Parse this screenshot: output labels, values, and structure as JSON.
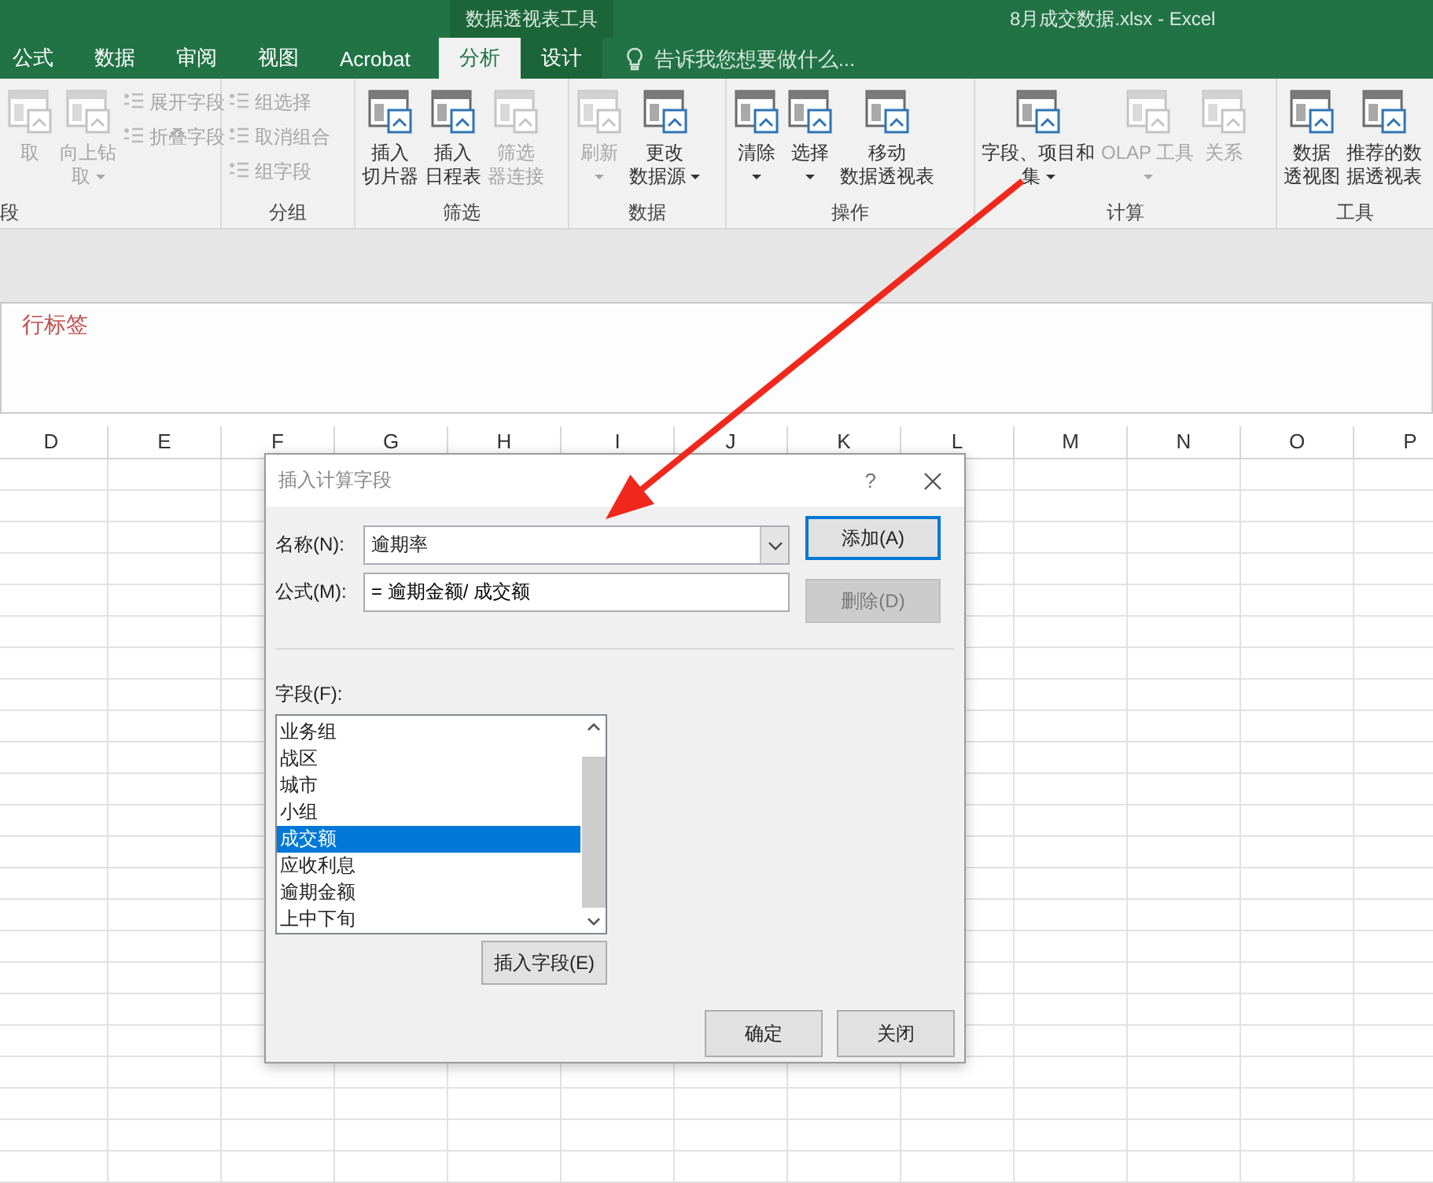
{
  "title_bar": {
    "context_group": "数据透视表工具",
    "document_title": "8月成交数据.xlsx - Excel"
  },
  "tabs": [
    {
      "label": "公式",
      "selected": false,
      "contextual": false
    },
    {
      "label": "数据",
      "selected": false,
      "contextual": false
    },
    {
      "label": "审阅",
      "selected": false,
      "contextual": false
    },
    {
      "label": "视图",
      "selected": false,
      "contextual": false
    },
    {
      "label": "Acrobat",
      "selected": false,
      "contextual": false
    },
    {
      "label": "分析",
      "selected": true,
      "contextual": true
    },
    {
      "label": "设计",
      "selected": false,
      "contextual": true
    }
  ],
  "tell_me": {
    "placeholder": "告诉我您想要做什么..."
  },
  "ribbon_groups": [
    {
      "label": "段",
      "buttons": [
        {
          "kind": "large",
          "lines": [
            "取"
          ],
          "dropdown": false,
          "disabled": true
        },
        {
          "kind": "large",
          "lines": [
            "向上钻",
            "取"
          ],
          "dropdown": true,
          "disabled": true
        },
        {
          "kind": "small",
          "lines": [
            "展开字段"
          ],
          "disabled": true
        },
        {
          "kind": "small",
          "lines": [
            "折叠字段"
          ],
          "disabled": true
        }
      ]
    },
    {
      "label": "分组",
      "buttons": [
        {
          "kind": "small",
          "lines": [
            "组选择"
          ],
          "disabled": true
        },
        {
          "kind": "small",
          "lines": [
            "取消组合"
          ],
          "disabled": true
        },
        {
          "kind": "small",
          "lines": [
            "组字段"
          ],
          "disabled": true
        }
      ]
    },
    {
      "label": "筛选",
      "buttons": [
        {
          "kind": "large",
          "lines": [
            "插入",
            "切片器"
          ],
          "dropdown": false,
          "disabled": false
        },
        {
          "kind": "large",
          "lines": [
            "插入",
            "日程表"
          ],
          "dropdown": false,
          "disabled": false
        },
        {
          "kind": "large",
          "lines": [
            "筛选",
            "器连接"
          ],
          "dropdown": false,
          "disabled": true
        }
      ]
    },
    {
      "label": "数据",
      "buttons": [
        {
          "kind": "large",
          "lines": [
            "刷新"
          ],
          "dropdown": true,
          "disabled": true
        },
        {
          "kind": "large",
          "lines": [
            "更改",
            "数据源"
          ],
          "dropdown": true,
          "disabled": false
        }
      ]
    },
    {
      "label": "操作",
      "buttons": [
        {
          "kind": "large",
          "lines": [
            "清除"
          ],
          "dropdown": true,
          "disabled": false
        },
        {
          "kind": "large",
          "lines": [
            "选择"
          ],
          "dropdown": true,
          "disabled": false
        },
        {
          "kind": "large",
          "lines": [
            "移动",
            "数据透视表"
          ],
          "dropdown": false,
          "disabled": false
        }
      ]
    },
    {
      "label": "计算",
      "buttons": [
        {
          "kind": "large",
          "lines": [
            "字段、项目和",
            "集"
          ],
          "dropdown": true,
          "disabled": false
        },
        {
          "kind": "large",
          "lines": [
            "OLAP 工具"
          ],
          "dropdown": true,
          "disabled": true
        },
        {
          "kind": "large",
          "lines": [
            "关系"
          ],
          "dropdown": false,
          "disabled": true
        }
      ]
    },
    {
      "label": "工具",
      "buttons": [
        {
          "kind": "large",
          "lines": [
            "数据",
            "透视图"
          ],
          "dropdown": false,
          "disabled": false
        },
        {
          "kind": "large",
          "lines": [
            "推荐的数",
            "据透视表"
          ],
          "dropdown": false,
          "disabled": false
        }
      ]
    }
  ],
  "pivot_area": {
    "row_labels": "行标签"
  },
  "columns": [
    "D",
    "E",
    "F",
    "G",
    "H",
    "I",
    "J",
    "K",
    "L",
    "M",
    "N",
    "O",
    "P"
  ],
  "dialog": {
    "title": "插入计算字段",
    "help": "?",
    "name": {
      "label": "名称(N):",
      "value": "逾期率"
    },
    "formula": {
      "label": "公式(M):",
      "value": "= 逾期金额/ 成交额"
    },
    "side_buttons": [
      {
        "label": "添加(A)",
        "default": true,
        "disabled": false
      },
      {
        "label": "删除(D)",
        "default": false,
        "disabled": true
      }
    ],
    "fields_label": "字段(F):",
    "fields": [
      {
        "label": "业务组",
        "selected": false
      },
      {
        "label": "战区",
        "selected": false
      },
      {
        "label": "城市",
        "selected": false
      },
      {
        "label": "小组",
        "selected": false
      },
      {
        "label": "成交额",
        "selected": true
      },
      {
        "label": "应收利息",
        "selected": false
      },
      {
        "label": "逾期金额",
        "selected": false
      },
      {
        "label": "上中下旬",
        "selected": false
      }
    ],
    "insert_button": "插入字段(E)",
    "footer_buttons": [
      "确定",
      "关闭"
    ]
  }
}
